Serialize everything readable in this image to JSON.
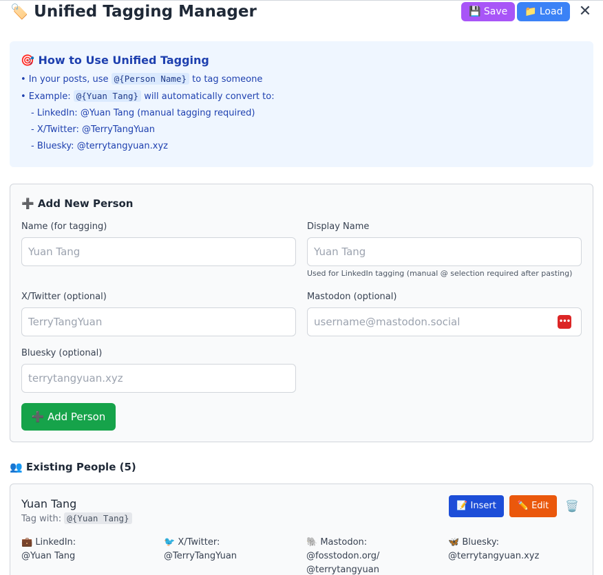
{
  "header": {
    "icon": "🏷️",
    "title": "Unified Tagging Manager",
    "save_label": "💾 Save",
    "load_label": "📁 Load",
    "close_label": "✕"
  },
  "howto": {
    "title": "🎯 How to Use Unified Tagging",
    "line1_pre": "• In your posts, use",
    "line1_code": "@{Person Name}",
    "line1_post": "to tag someone",
    "line2_pre": "• Example:",
    "line2_code": "@{Yuan Tang}",
    "line2_post": "will automatically convert to:",
    "sub": [
      "- LinkedIn: @Yuan Tang (manual tagging required)",
      "- X/Twitter: @TerryTangYuan",
      "- Bluesky: @terrytangyuan.xyz"
    ]
  },
  "add_person": {
    "title": "➕ Add New Person",
    "name_label": "Name (for tagging)",
    "name_placeholder": "Yuan Tang",
    "display_label": "Display Name",
    "display_placeholder": "Yuan Tang",
    "display_hint": "Used for LinkedIn tagging (manual @ selection required after pasting)",
    "x_label": "X/Twitter (optional)",
    "x_placeholder": "TerryTangYuan",
    "mastodon_label": "Mastodon (optional)",
    "mastodon_placeholder": "username@mastodon.social",
    "bluesky_label": "Bluesky (optional)",
    "bluesky_placeholder": "terrytangyuan.xyz",
    "add_button": "➕ Add Person",
    "password_icon": "•••"
  },
  "existing": {
    "title": "👥 Existing People (5)",
    "people": [
      {
        "name": "Yuan Tang",
        "tag_prefix": "Tag with:",
        "tag_code": "@{Yuan Tang}",
        "insert_label": "📝 Insert",
        "edit_label": "✏️ Edit",
        "delete_icon": "🗑️",
        "linkedin_label": "💼 LinkedIn:",
        "linkedin_value": "@Yuan Tang",
        "x_label": "🐦 X/Twitter:",
        "x_value": "@TerryTangYuan",
        "mastodon_label": "🐘 Mastodon:",
        "mastodon_value1": "@fosstodon.org/",
        "mastodon_value2": "@terrytangyuan",
        "bluesky_label": "🦋 Bluesky:",
        "bluesky_value": "@terrytangyuan.xyz"
      }
    ]
  }
}
